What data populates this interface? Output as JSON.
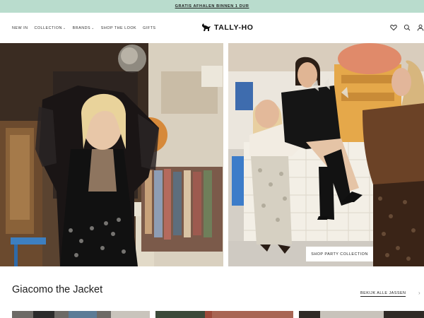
{
  "announcement": {
    "text": "GRATIS AFHALEN BINNEN 1 DUR"
  },
  "brand": {
    "name": "TALLY-HO"
  },
  "nav": {
    "items": [
      {
        "label": "NEW IN",
        "dropdown": false
      },
      {
        "label": "COLLECTION",
        "dropdown": true
      },
      {
        "label": "BRANDS",
        "dropdown": true
      },
      {
        "label": "SHOP THE LOOK",
        "dropdown": false
      },
      {
        "label": "GIFTS",
        "dropdown": false
      }
    ]
  },
  "header_icons": [
    "heart-icon",
    "search-icon",
    "account-icon"
  ],
  "hero": {
    "cta_label": "SHOP PARTY COLLECTION"
  },
  "section": {
    "title": "Giacomo the Jacket",
    "see_all_label": "BEKIJK ALLE JASSEN"
  },
  "colors": {
    "announcement_bg": "#b9dccd",
    "text": "#1d1d1d"
  }
}
